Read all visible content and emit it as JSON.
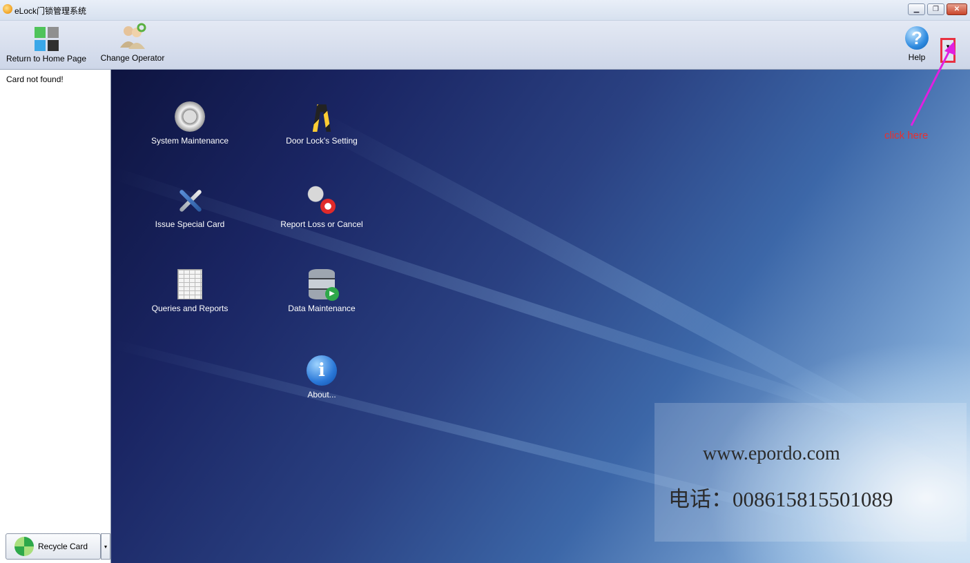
{
  "window": {
    "title": "eLock门锁管理系统",
    "controls": [
      "minimize-icon",
      "restore-icon",
      "close-icon"
    ]
  },
  "toolbar": {
    "home_label": "Return to Home Page",
    "operator_label": "Change Operator",
    "help_label": "Help",
    "dropdown_icon": "▾"
  },
  "left_pane": {
    "status": "Card not found!",
    "recycle_button": "Recycle Card",
    "recycle_dropdown_icon": "▾"
  },
  "modules": [
    {
      "label": "System Maintenance",
      "icon": "gear-icon"
    },
    {
      "label": "Door Lock's Setting",
      "icon": "road-barrier-icon"
    },
    {
      "label": "Issue Special Card",
      "icon": "tools-icon"
    },
    {
      "label": "Report Loss or Cancel",
      "icon": "key-cancel-icon"
    },
    {
      "label": "Queries and Reports",
      "icon": "spreadsheet-icon"
    },
    {
      "label": "Data Maintenance",
      "icon": "database-icon"
    },
    {
      "label": "About...",
      "icon": "info-icon"
    }
  ],
  "annotation": {
    "text": "click here",
    "color": "#e8302f",
    "arrow_color": "#e020e0"
  },
  "watermark": {
    "url": "www.epordo.com",
    "phone": "电话：008615815501089"
  }
}
